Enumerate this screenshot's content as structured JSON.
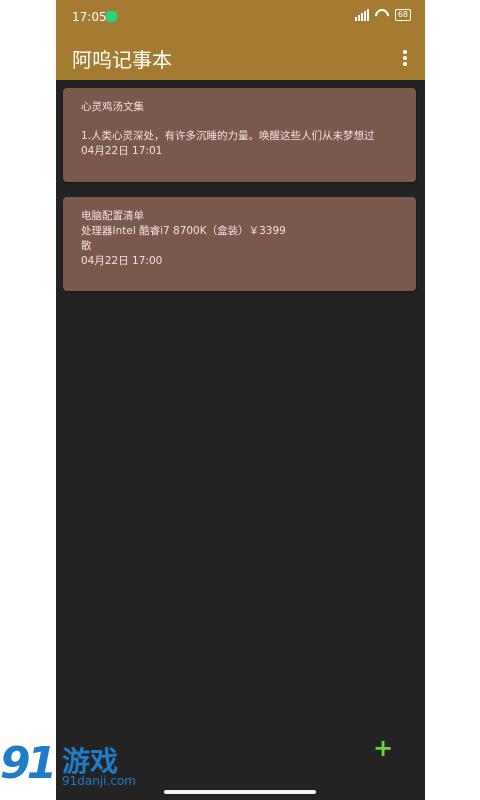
{
  "statusbar": {
    "time": "17:05",
    "battery": "68"
  },
  "appbar": {
    "title": "阿呜记事本"
  },
  "notes": [
    {
      "title": "心灵鸡汤文集",
      "body": "1.人类心灵深处，有许多沉睡的力量。唤醒这些人们从未梦想过",
      "date": "04月22日 17:01"
    },
    {
      "title": "电脑配置清单",
      "body": "处理器Intel 酷睿i7 8700K（盒装）￥3399",
      "extra": "散",
      "date": "04月22日 17:00"
    }
  ],
  "fab": {
    "symbol": "+"
  },
  "watermark": {
    "number": "91",
    "brand": "游戏",
    "url": "91danji.com"
  }
}
